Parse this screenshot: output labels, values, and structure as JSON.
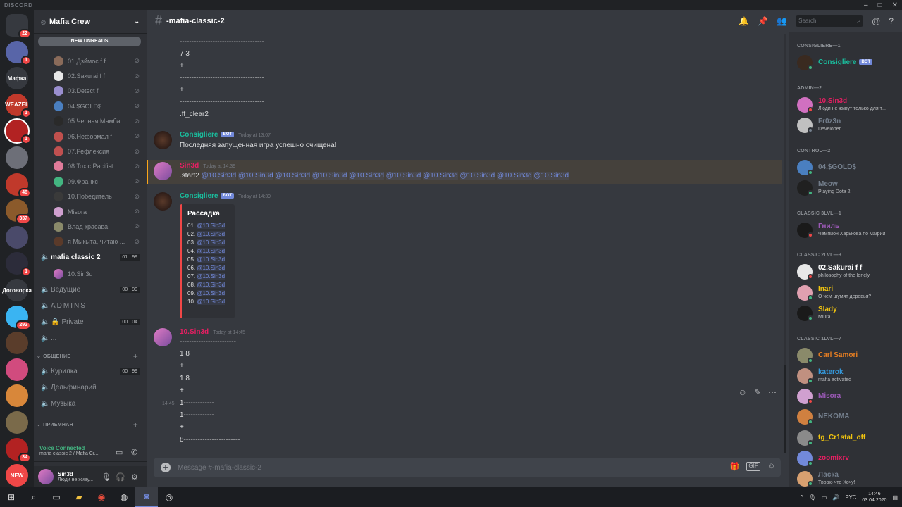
{
  "app": {
    "title": "DISCORD"
  },
  "servers": [
    {
      "label": "",
      "color": "#36393f",
      "badge": "22",
      "kind": "home"
    },
    {
      "label": "",
      "color": "#5865a8",
      "badge": "1"
    },
    {
      "label": "Мафка",
      "color": "#36393f",
      "badge": ""
    },
    {
      "label": "WEAZEL",
      "color": "#c0392b",
      "badge": "1"
    },
    {
      "label": "",
      "color": "#b22222",
      "badge": "1",
      "active": true
    },
    {
      "label": "",
      "color": "#6d6f78",
      "badge": ""
    },
    {
      "label": "",
      "color": "#c0392b",
      "badge": "48"
    },
    {
      "label": "",
      "color": "#8b5a2b",
      "badge": "337"
    },
    {
      "label": "",
      "color": "#4a4a6a",
      "badge": ""
    },
    {
      "label": "",
      "color": "#2c2c3a",
      "badge": "1"
    },
    {
      "label": "Договорка",
      "color": "#36393f",
      "badge": ""
    },
    {
      "label": "",
      "color": "#3ab4f2",
      "badge": "292"
    },
    {
      "label": "",
      "color": "#5a3d2b",
      "badge": ""
    },
    {
      "label": "",
      "color": "#d14b7e",
      "badge": ""
    },
    {
      "label": "",
      "color": "#d8873a",
      "badge": ""
    },
    {
      "label": "",
      "color": "#7a6a4a",
      "badge": ""
    },
    {
      "label": "",
      "color": "#b22222",
      "badge": "34"
    },
    {
      "label": "NEW",
      "color": "#f04747",
      "badge": ""
    }
  ],
  "guild": {
    "name": "Mafia Crew",
    "new_unreads": "NEW UNREADS"
  },
  "voice_users": [
    {
      "name": "01.Дзймос f f",
      "color": "#8a6b5a"
    },
    {
      "name": "02.Sakurai f f",
      "color": "#e8e8e8"
    },
    {
      "name": "03.Detect f",
      "color": "#9a8fd0"
    },
    {
      "name": "04.$GOLD$",
      "color": "#4a7fc0"
    },
    {
      "name": "05.Черная Мамба",
      "color": "#2a2a2a"
    },
    {
      "name": "06.Неформал f",
      "color": "#c0504d"
    },
    {
      "name": "07.Рефлексия",
      "color": "#c05050"
    },
    {
      "name": "08.Toxic Pacifist",
      "color": "#e07b9a"
    },
    {
      "name": "09.Франкс",
      "color": "#43b581"
    },
    {
      "name": "10.Победитель",
      "color": "#3a3a3a"
    },
    {
      "name": "Misora",
      "color": "#d0a0d0"
    },
    {
      "name": "Влад красава",
      "color": "#8a8a6a"
    },
    {
      "name": "я Мыкыта, читаю ...",
      "color": "#5a3a2a"
    }
  ],
  "channels": {
    "mafia_classic_2": {
      "name": "mafia classic 2",
      "c1": "01",
      "c2": "99"
    },
    "sin3d": "10.Sin3d",
    "vedushie": {
      "name": "Ведущие",
      "c1": "00",
      "c2": "99"
    },
    "admins": "ADMINS",
    "private": {
      "name": "Private",
      "c1": "00",
      "c2": "04"
    },
    "dots": "...",
    "cat_obshenie": "ОБЩЕНИЕ",
    "kurilka": {
      "name": "Курилка",
      "c1": "00",
      "c2": "99"
    },
    "delfinariy": "Дельфинарий",
    "muzyka": "Музыка",
    "cat_priemnaya": "ПРИЕМНАЯ"
  },
  "voice": {
    "status": "Voice Connected",
    "sub": "mafia classic 2 / Mafia Cr..."
  },
  "user": {
    "name": "Sin3d",
    "status": "Люди не живу..."
  },
  "chat": {
    "channel": "-mafia-classic-2",
    "search": "Search",
    "lines_top": [
      "------------------------------------",
      "7 3",
      "+",
      "------------------------------------",
      "+",
      "------------------------------------",
      ".ff_clear2"
    ],
    "msg1": {
      "author": "Consigliere",
      "bot": "BOT",
      "time": "Today at 13:07",
      "text": "Последняя запущенная игра успешно очищена!"
    },
    "msg2": {
      "author": "Sin3d",
      "time": "Today at 14:39",
      "cmd": ".start2",
      "mention": "@10.Sin3d"
    },
    "msg3": {
      "author": "Consigliere",
      "bot": "BOT",
      "time": "Today at 14:39",
      "embed_title": "Рассадка",
      "rows": [
        "01.",
        "02.",
        "03.",
        "04.",
        "05.",
        "06.",
        "07.",
        "08.",
        "09.",
        "10."
      ],
      "mention": "@10.Sin3d"
    },
    "msg4": {
      "author": "10.Sin3d",
      "time": "Today at 14:45",
      "lines": [
        "------------------------",
        "1 8",
        "+",
        "1 8",
        "+"
      ]
    },
    "msg5": {
      "time": "14:45",
      "lines": [
        "1-------------",
        "1-------------",
        "+",
        "8------------------------"
      ]
    },
    "composer": "Message #-mafia-classic-2"
  },
  "members": {
    "groups": [
      {
        "title": "CONSIGLIERE—1",
        "items": [
          {
            "name": "Consigliere",
            "color": "#1abc9c",
            "bot": "BOT",
            "sub": "",
            "av": "#3a2a20",
            "status": "#43b581"
          }
        ]
      },
      {
        "title": "ADMIN—2",
        "items": [
          {
            "name": "10.Sin3d",
            "color": "#e91e63",
            "sub": "Люди не живут только для т...",
            "av": "#d070c0",
            "status": "#f04747"
          },
          {
            "name": "Fr0z3n",
            "color": "#747f8d",
            "sub": "Developer",
            "av": "#c0c0c0",
            "status": "#747f8d"
          }
        ]
      },
      {
        "title": "CONTROL—2",
        "items": [
          {
            "name": "04.$GOLD$",
            "color": "#747f8d",
            "sub": "",
            "av": "#4a7fc0",
            "status": "#43b581"
          },
          {
            "name": "Meow",
            "color": "#747f8d",
            "sub": "Playing Dota 2",
            "av": "#202020",
            "status": "#43b581"
          }
        ]
      },
      {
        "title": "CLASSIC 3LVL—1",
        "items": [
          {
            "name": "Гниль",
            "color": "#9b59b6",
            "sub": "Чемпион Харькова по мафии",
            "av": "#1a1a1a",
            "status": "#f04747"
          }
        ]
      },
      {
        "title": "CLASSIC 2LVL—3",
        "items": [
          {
            "name": "02.Sakurai f f",
            "color": "#ffffff",
            "sub": "philosophy of the lonely",
            "av": "#e8e8e8",
            "status": "#f04747"
          },
          {
            "name": "Inari",
            "color": "#f1c40f",
            "sub": "О чем шумят деревья?",
            "av": "#e0a0b0",
            "status": "#43b581"
          },
          {
            "name": "Slady",
            "color": "#f1c40f",
            "sub": "Miura",
            "av": "#1a1a1a",
            "status": "#43b581"
          }
        ]
      },
      {
        "title": "CLASSIC 1LVL—7",
        "items": [
          {
            "name": "Carl Samori",
            "color": "#e67e22",
            "sub": "",
            "av": "#8a8a6a",
            "status": "#43b581"
          },
          {
            "name": "katerok",
            "color": "#3498db",
            "sub": "mafia activated",
            "av": "#c09080",
            "status": "#43b581"
          },
          {
            "name": "Misora",
            "color": "#9b59b6",
            "sub": "",
            "av": "#d0a0d0",
            "status": "#f04747"
          },
          {
            "name": "NEKOMA",
            "color": "#747f8d",
            "sub": "",
            "av": "#d08040",
            "status": "#43b581"
          },
          {
            "name": "tg_Cr1stal_off",
            "color": "#f1c40f",
            "sub": "",
            "av": "#8a8a8a",
            "status": "#43b581"
          },
          {
            "name": "zoomixrv",
            "color": "#e91e63",
            "sub": "",
            "av": "#7289da",
            "status": "#43b581"
          },
          {
            "name": "Ласка",
            "color": "#747f8d",
            "sub": "Творю что Хочу!",
            "av": "#d8a070",
            "status": "#43b581"
          }
        ]
      }
    ]
  },
  "taskbar": {
    "lang": "РУС",
    "time": "14:46",
    "date": "03.04.2020"
  }
}
